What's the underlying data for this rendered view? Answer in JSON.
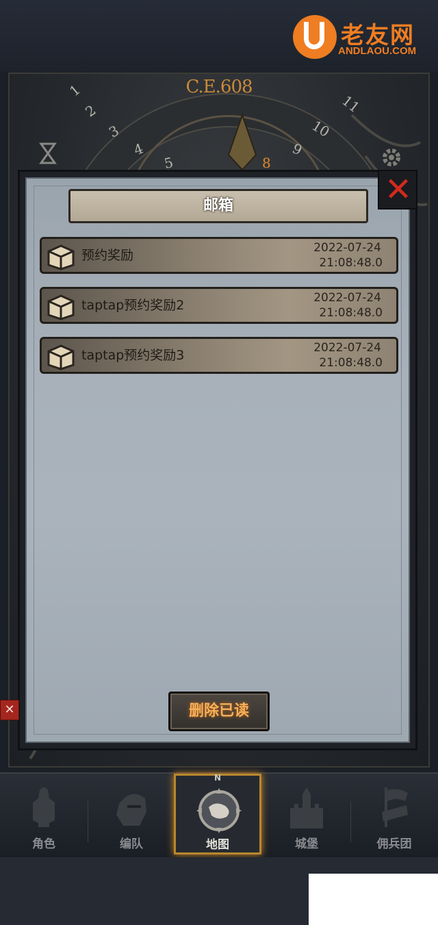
{
  "watermark": {
    "title": "老友网",
    "subtitle": "ANDLAOU.COM"
  },
  "dial": {
    "era": "C.E.608",
    "numbers_left": [
      "1",
      "2",
      "3",
      "4",
      "5"
    ],
    "numbers_right": [
      "9",
      "10",
      "11"
    ],
    "current": "8"
  },
  "mailbox": {
    "title": "邮箱",
    "items": [
      {
        "title": "预约奖励",
        "date": "2022-07-24",
        "time": "21:08:48.0"
      },
      {
        "title": "taptap预约奖励2",
        "date": "2022-07-24",
        "time": "21:08:48.0"
      },
      {
        "title": "taptap预约奖励3",
        "date": "2022-07-24",
        "time": "21:08:48.0"
      }
    ],
    "delete_read_label": "删除已读"
  },
  "bottom_nav": {
    "items": [
      {
        "label": "角色",
        "icon": "knight-icon"
      },
      {
        "label": "编队",
        "icon": "helmet-icon"
      },
      {
        "label": "地图",
        "icon": "compass-map-icon",
        "active": true
      },
      {
        "label": "城堡",
        "icon": "castle-icon"
      },
      {
        "label": "佣兵团",
        "icon": "banner-icon"
      }
    ],
    "compass_letter": "N"
  },
  "colors": {
    "accent": "#e08a2c",
    "close": "#d12a1d",
    "active_border": "#b8872e"
  }
}
